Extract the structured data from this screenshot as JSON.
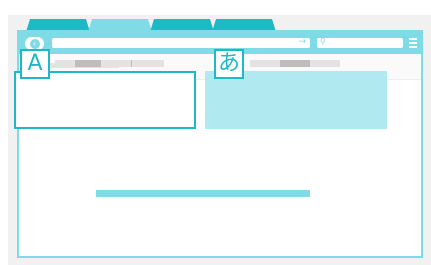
{
  "browser": {
    "tabs": [
      {
        "state": "inactive"
      },
      {
        "state": "active"
      },
      {
        "state": "inactive"
      },
      {
        "state": "inactive"
      }
    ],
    "icons": {
      "back": "back-arrow-icon",
      "go": "go-arrow-icon",
      "search": "search-icon",
      "menu": "hamburger-menu-icon"
    }
  },
  "panels": {
    "source": {
      "glyph": "A"
    },
    "target": {
      "glyph": "あ"
    }
  },
  "colors": {
    "accent_dark": "#1fb8c6",
    "accent": "#7fdbe6",
    "accent_light": "#b1e9f0",
    "placeholder": "#e3e3e3",
    "placeholder_dark": "#bdbdbd"
  }
}
